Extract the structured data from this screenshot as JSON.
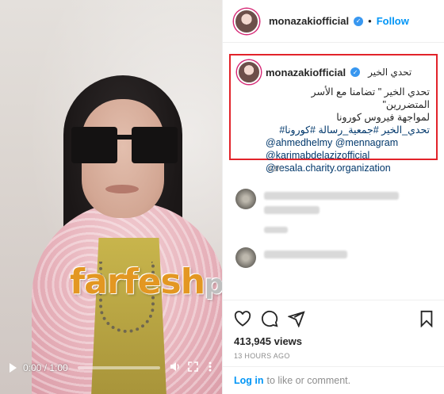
{
  "video": {
    "time_display": "0:00 / 1:00",
    "watermark_part1": "farfesh",
    "watermark_part2": "plus.com"
  },
  "post": {
    "username": "monazakiofficial",
    "follow_label": "Follow",
    "dot": "•",
    "caption_title": "تحدي الخير",
    "caption_line1": "تحدي الخير \" تضامنا مع الأسر المتضررين\"",
    "caption_line2": "لمواجهة فيروس كورونا",
    "hashtags": "تحدي_الخير #جمعية_رسالة #كورونا#",
    "mentions": [
      "@ahmedhelmy @mennagram",
      "@karimabdelazizofficial",
      "@resala.charity.organization"
    ],
    "caption_time": "13h",
    "views": "413,945 views",
    "posted_ago": "13 HOURS AGO",
    "login_link": "Log in",
    "login_text": "to like or comment."
  },
  "colors": {
    "accent": "#0095f6",
    "highlight_border": "#e2232a",
    "watermark_orange": "#e39722"
  }
}
